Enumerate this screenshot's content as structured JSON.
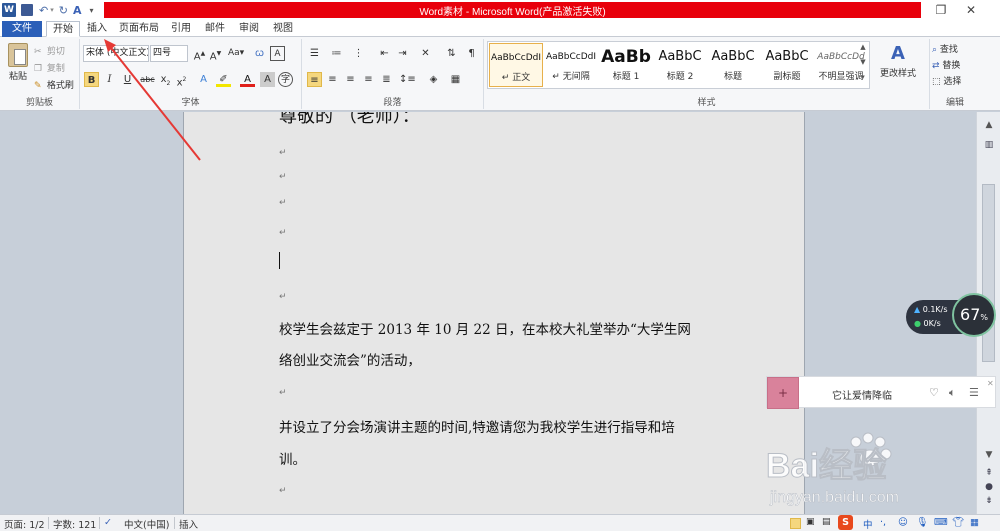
{
  "app": {
    "title": "Word素材 - Microsoft Word(产品激活失败)"
  },
  "tabs": [
    {
      "label": "文件"
    },
    {
      "label": "开始"
    },
    {
      "label": "插入"
    },
    {
      "label": "页面布局"
    },
    {
      "label": "引用"
    },
    {
      "label": "邮件"
    },
    {
      "label": "审阅"
    },
    {
      "label": "视图"
    }
  ],
  "ribbon": {
    "clipboard": {
      "paste": "粘贴",
      "cut": "剪切",
      "copy": "复制",
      "format_painter": "格式刷",
      "label": "剪贴板"
    },
    "font": {
      "font_name": "宋体 (中文正文)",
      "font_size": "四号",
      "label": "字体"
    },
    "paragraph": {
      "label": "段落"
    },
    "styles": {
      "items": [
        {
          "preview": "AaBbCcDdI",
          "name": "↵ 正文"
        },
        {
          "preview": "AaBbCcDdI",
          "name": "↵ 无间隔"
        },
        {
          "preview": "AaBb",
          "name": "标题 1"
        },
        {
          "preview": "AaBbC",
          "name": "标题 2"
        },
        {
          "preview": "AaBbC",
          "name": "标题"
        },
        {
          "preview": "AaBbC",
          "name": "副标题"
        },
        {
          "preview": "AaBbCcDd",
          "name": "不明显强调"
        }
      ],
      "change_styles": "更改样式",
      "label": "样式"
    },
    "editing": {
      "find": "查找",
      "replace": "替换",
      "select": "选择",
      "label": "编辑"
    }
  },
  "document": {
    "heading": "尊敬的           （老师）：",
    "para1_line1": "校学生会兹定于 2013 年 10 月 22 日，在本校大礼堂举办“大学生网",
    "para1_line2": "络创业交流会”的活动，",
    "para2_line1": "并设立了分会场演讲主题的时间,特邀请您为我校学生进行指导和培",
    "para2_line2": "训。",
    "para_mark": "↵"
  },
  "network_widget": {
    "upload": "0.1K/s",
    "download": "0K/s",
    "percent": "67",
    "percent_unit": "%"
  },
  "music_widget": {
    "song": "它让爱情降临"
  },
  "status_bar": {
    "page": "页面: 1/2",
    "words": "字数: 121",
    "language": "中文(中国)",
    "mode": "插入"
  },
  "tray": {
    "ime": "中"
  },
  "watermark": {
    "brand": "Bai经验",
    "url": "jingyan.baidu.com"
  }
}
